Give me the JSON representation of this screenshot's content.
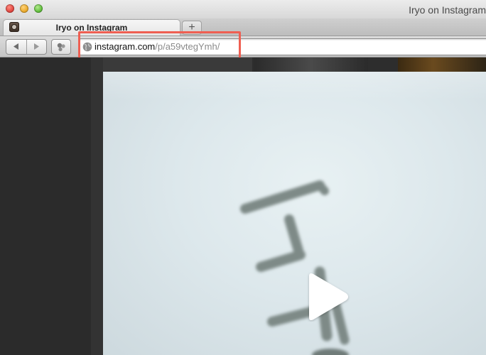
{
  "window": {
    "title": "Iryo on Instagram"
  },
  "tabs": [
    {
      "label": "Iryo on Instagram",
      "favicon": "instagram-icon"
    }
  ],
  "new_tab_label": "+",
  "toolbar": {
    "back_icon": "back-arrow-icon",
    "forward_icon": "forward-arrow-icon",
    "extension_icon": "extension-icon"
  },
  "address_bar": {
    "domain": "instagram.com",
    "path": "/p/a59vtegYmh/",
    "icon": "globe-icon",
    "highlight_color": "#ef5f52"
  },
  "video": {
    "play_icon": "play-icon",
    "shows_handwritten_characters": ""
  },
  "colors": {
    "highlight": "#ef5f52",
    "content_bg": "#2d2d2d"
  }
}
